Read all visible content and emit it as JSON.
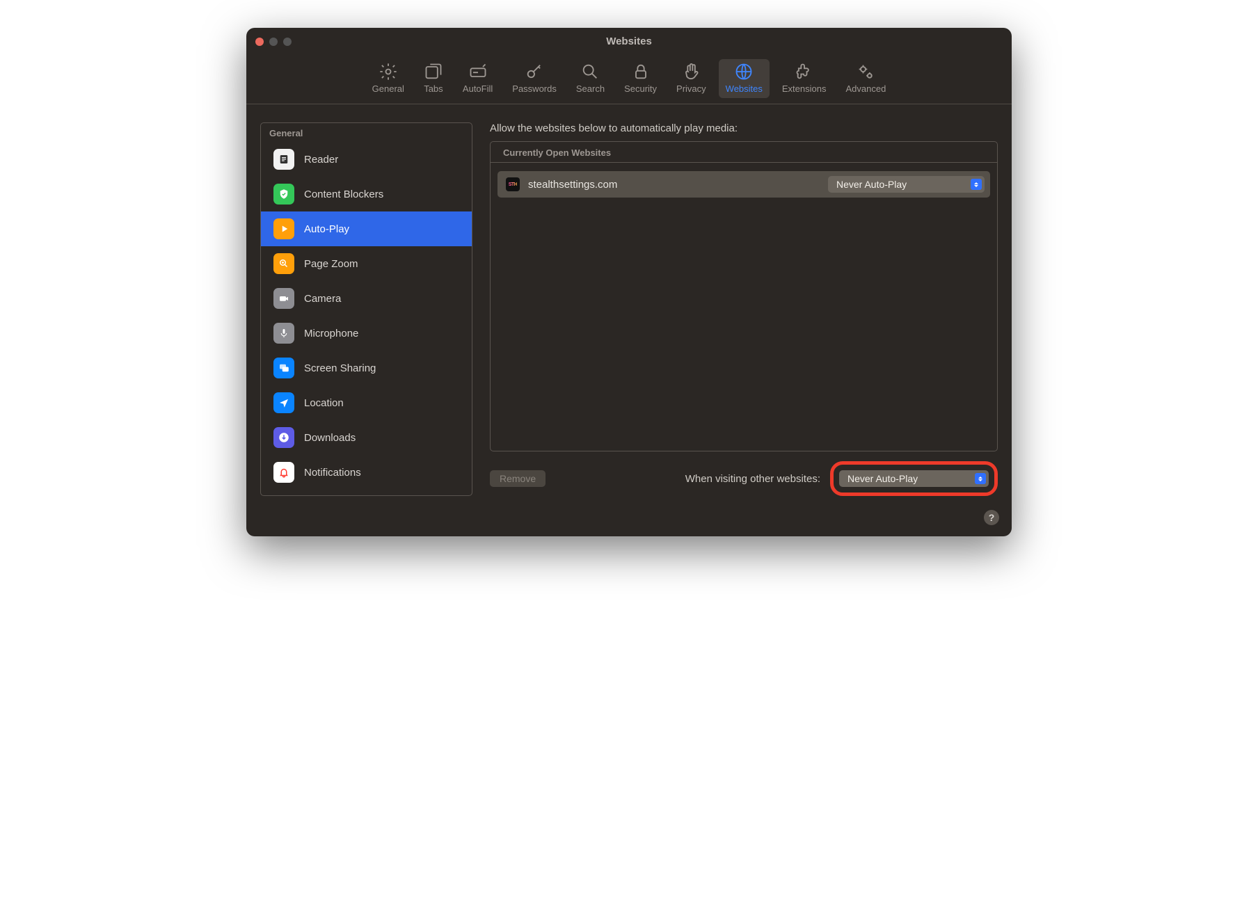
{
  "window": {
    "title": "Websites"
  },
  "toolbar": [
    {
      "label": "General"
    },
    {
      "label": "Tabs"
    },
    {
      "label": "AutoFill"
    },
    {
      "label": "Passwords"
    },
    {
      "label": "Search"
    },
    {
      "label": "Security"
    },
    {
      "label": "Privacy"
    },
    {
      "label": "Websites"
    },
    {
      "label": "Extensions"
    },
    {
      "label": "Advanced"
    }
  ],
  "sidebar": {
    "header": "General",
    "items": [
      {
        "label": "Reader"
      },
      {
        "label": "Content Blockers"
      },
      {
        "label": "Auto-Play"
      },
      {
        "label": "Page Zoom"
      },
      {
        "label": "Camera"
      },
      {
        "label": "Microphone"
      },
      {
        "label": "Screen Sharing"
      },
      {
        "label": "Location"
      },
      {
        "label": "Downloads"
      },
      {
        "label": "Notifications"
      }
    ]
  },
  "main": {
    "header": "Allow the websites below to automatically play media:",
    "section_header": "Currently Open Websites",
    "sites": [
      {
        "favicon_text": "STH",
        "name": "stealthsettings.com",
        "setting": "Never Auto-Play"
      }
    ],
    "remove_label": "Remove",
    "other_label": "When visiting other websites:",
    "other_value": "Never Auto-Play"
  },
  "help_label": "?"
}
